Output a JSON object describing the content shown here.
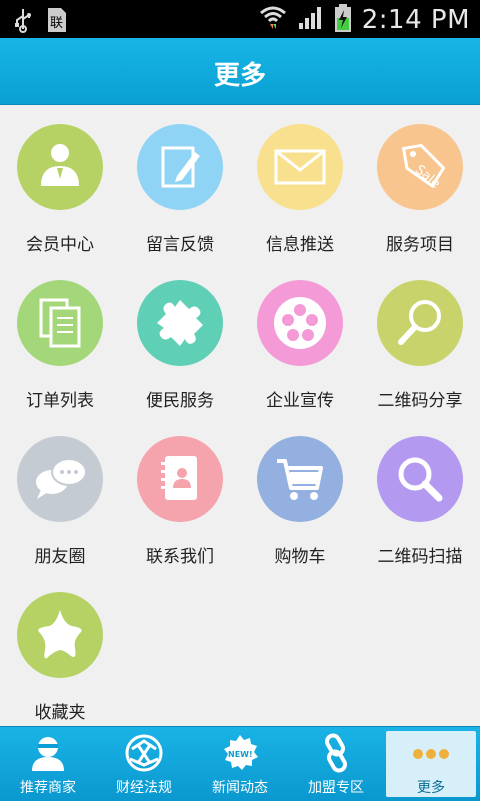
{
  "status_bar": {
    "time": "2:14 PM"
  },
  "header": {
    "title": "更多"
  },
  "grid": {
    "items": [
      {
        "label": "会员中心",
        "icon": "member-icon",
        "color": "#b6d265"
      },
      {
        "label": "留言反馈",
        "icon": "feedback-icon",
        "color": "#8fd3f5"
      },
      {
        "label": "信息推送",
        "icon": "mail-icon",
        "color": "#f9e08f"
      },
      {
        "label": "服务项目",
        "icon": "sale-tag-icon",
        "color": "#f7c58d"
      },
      {
        "label": "订单列表",
        "icon": "document-list-icon",
        "color": "#a3d77a"
      },
      {
        "label": "便民服务",
        "icon": "puzzle-icon",
        "color": "#5fcfb6"
      },
      {
        "label": "企业宣传",
        "icon": "film-reel-icon",
        "color": "#f49bd7"
      },
      {
        "label": "二维码分享",
        "icon": "magnifier-icon",
        "color": "#c9d36b"
      },
      {
        "label": "朋友圈",
        "icon": "chat-bubbles-icon",
        "color": "#c5cbd3"
      },
      {
        "label": "联系我们",
        "icon": "contacts-book-icon",
        "color": "#f5a3ad"
      },
      {
        "label": "购物车",
        "icon": "shopping-cart-icon",
        "color": "#93b0e0"
      },
      {
        "label": "二维码扫描",
        "icon": "scan-search-icon",
        "color": "#b39af0"
      },
      {
        "label": "收藏夹",
        "icon": "star-icon",
        "color": "#b6d265"
      }
    ]
  },
  "bottom_nav": {
    "items": [
      {
        "label": "推荐商家",
        "icon": "merchant-icon"
      },
      {
        "label": "财经法规",
        "icon": "finance-icon"
      },
      {
        "label": "新闻动态",
        "icon": "news-badge-icon",
        "badge": "NEW!"
      },
      {
        "label": "加盟专区",
        "icon": "link-icon"
      },
      {
        "label": "更多",
        "icon": "more-dots-icon",
        "active": true
      }
    ]
  }
}
